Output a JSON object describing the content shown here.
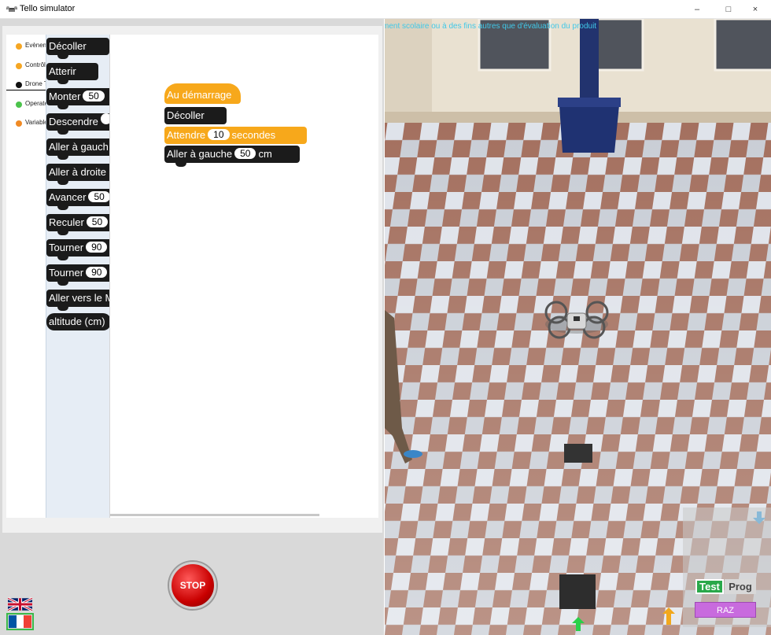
{
  "window": {
    "title": "Tello simulator",
    "minimize": "–",
    "maximize": "□",
    "close": "×"
  },
  "toolbox": {
    "categories": [
      {
        "label": "Evènements",
        "color": "#f5a623"
      },
      {
        "label": "Contrôles",
        "color": "#f5a623"
      },
      {
        "label": "Drone Tello",
        "color": "#111111"
      },
      {
        "label": "Operateurs",
        "color": "#4cc34c"
      },
      {
        "label": "Variables",
        "color": "#f08a24"
      }
    ]
  },
  "flyout": {
    "blocks": [
      {
        "text": "Décoller"
      },
      {
        "text": "Atterir"
      },
      {
        "text": "Monter",
        "value": "50"
      },
      {
        "text": "Descendre",
        "value": ""
      },
      {
        "text": "Aller à gauch"
      },
      {
        "text": "Aller à droite"
      },
      {
        "text": "Avancer",
        "value": "50"
      },
      {
        "text": "Reculer",
        "value": "50"
      },
      {
        "text": "Tourner",
        "value": "90"
      },
      {
        "text": "Tourner",
        "value": "90"
      },
      {
        "text": "Aller vers le M"
      },
      {
        "text": "altitude (cm)"
      }
    ]
  },
  "program": {
    "start": "Au démarrage",
    "takeoff": "Décoller",
    "wait_label": "Attendre",
    "wait_value": "10",
    "wait_unit": "secondes",
    "left_label": "Aller à gauche",
    "left_value": "50",
    "left_unit": "cm"
  },
  "controls": {
    "stop": "STOP"
  },
  "scene": {
    "watermark": "ment scolaire ou à des fins autres que d'évaluation du produit",
    "test": "Test",
    "prog": "Prog",
    "raz": "RAZ"
  }
}
